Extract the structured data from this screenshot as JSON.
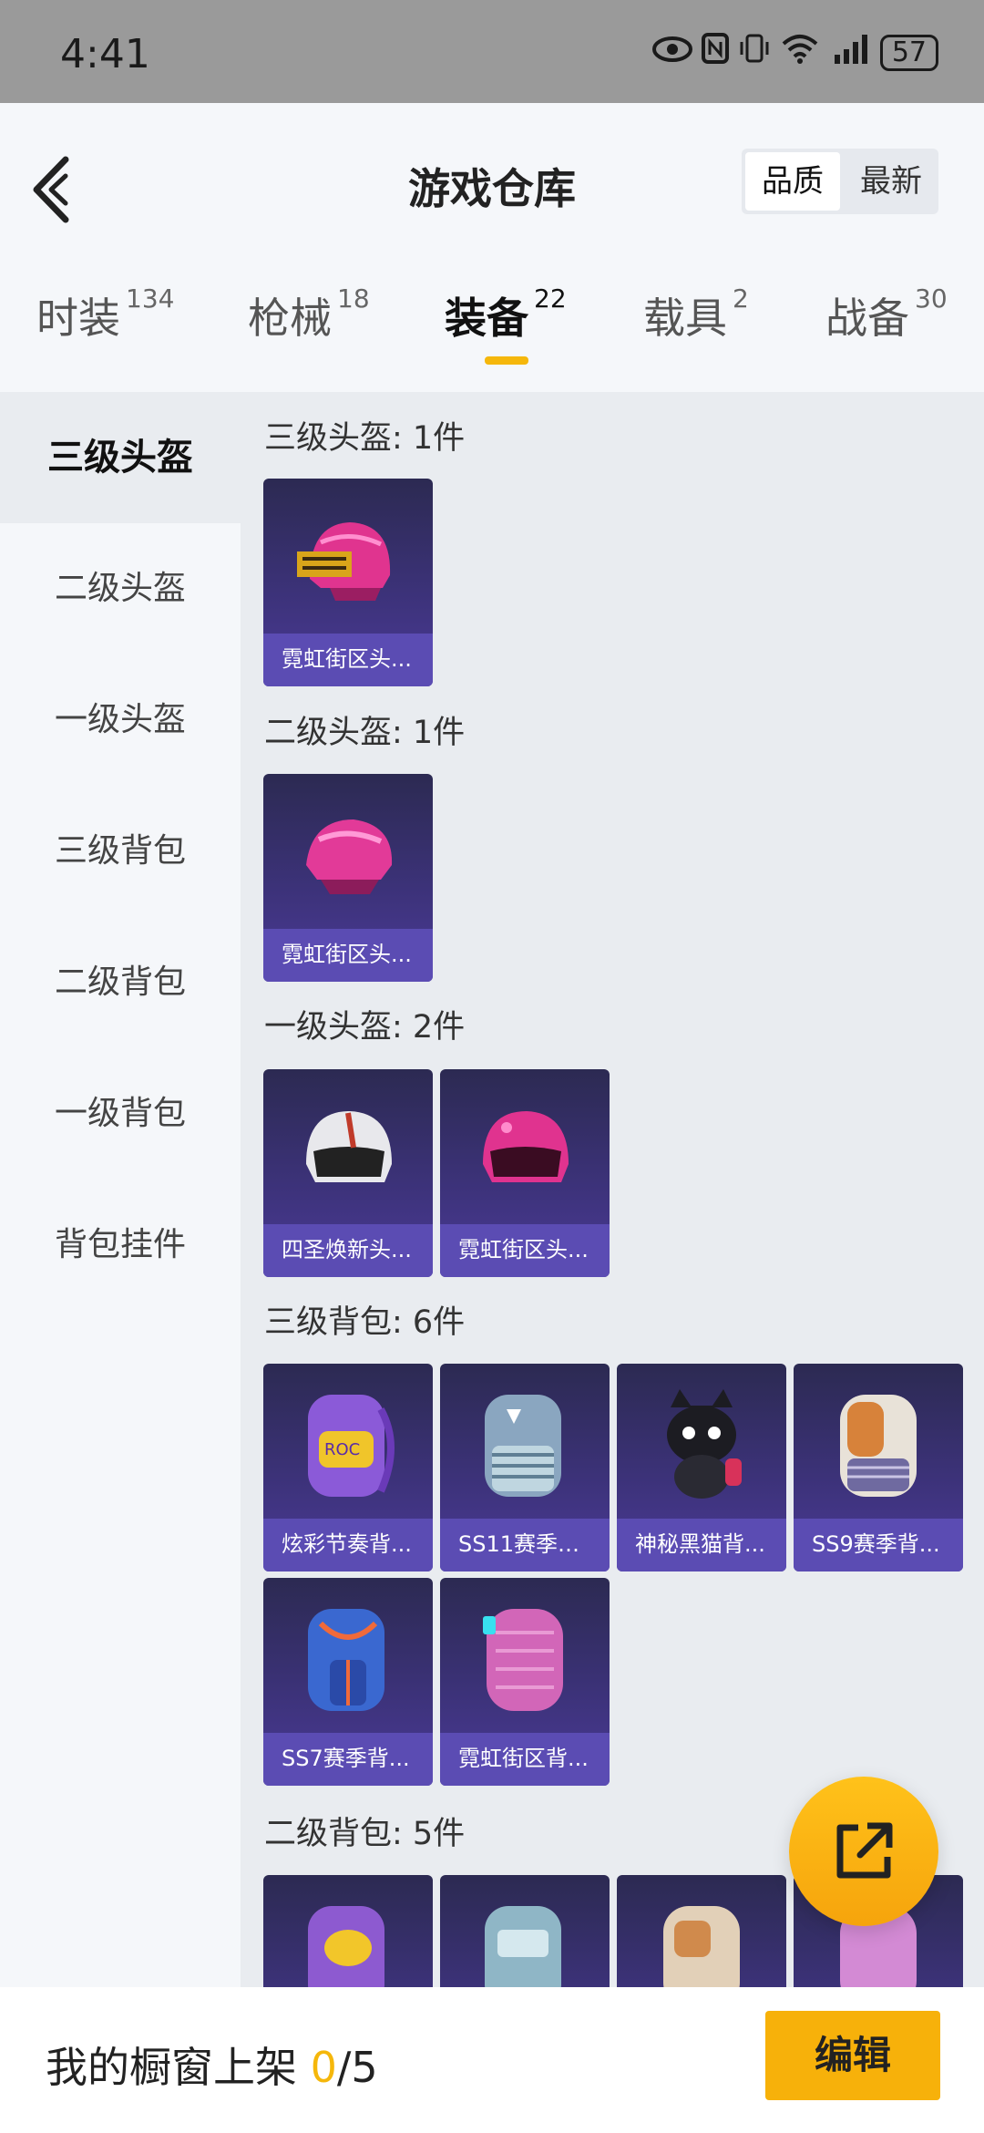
{
  "status_bar": {
    "time": "4:41",
    "battery": "57",
    "icons": [
      "eye-icon",
      "nfc-icon",
      "vibrate-icon",
      "wifi-icon",
      "signal-4g-icon",
      "battery-icon"
    ]
  },
  "header": {
    "title": "游戏仓库",
    "sort_options": [
      "品质",
      "最新"
    ],
    "active_sort": "品质"
  },
  "tabs": [
    {
      "label": "时装",
      "count": "134"
    },
    {
      "label": "枪械",
      "count": "18"
    },
    {
      "label": "装备",
      "count": "22",
      "active": true
    },
    {
      "label": "载具",
      "count": "2"
    },
    {
      "label": "战备",
      "count": "30"
    }
  ],
  "sidebar": {
    "items": [
      "三级头盔",
      "二级头盔",
      "一级头盔",
      "三级背包",
      "二级背包",
      "一级背包",
      "背包挂件"
    ],
    "active": "三级头盔"
  },
  "sections": [
    {
      "title": "三级头盔: 1件",
      "items": [
        "霓虹街区头..."
      ]
    },
    {
      "title": "二级头盔: 1件",
      "items": [
        "霓虹街区头..."
      ]
    },
    {
      "title": "一级头盔: 2件",
      "items": [
        "四圣焕新头...",
        "霓虹街区头..."
      ]
    },
    {
      "title": "三级背包: 6件",
      "items": [
        "炫彩节奏背...",
        "SS11赛季背...",
        "神秘黑猫背...",
        "SS9赛季背...",
        "SS7赛季背...",
        "霓虹街区背..."
      ]
    },
    {
      "title": "二级背包: 5件",
      "items": []
    }
  ],
  "bottom_bar": {
    "label": "我的橱窗上架 ",
    "count": "0",
    "total": "/5",
    "edit_label": "编辑"
  },
  "colors": {
    "accent": "#f5b70b",
    "card_bg": "#3c3279",
    "card_label_bg": "#5b4cb3"
  }
}
